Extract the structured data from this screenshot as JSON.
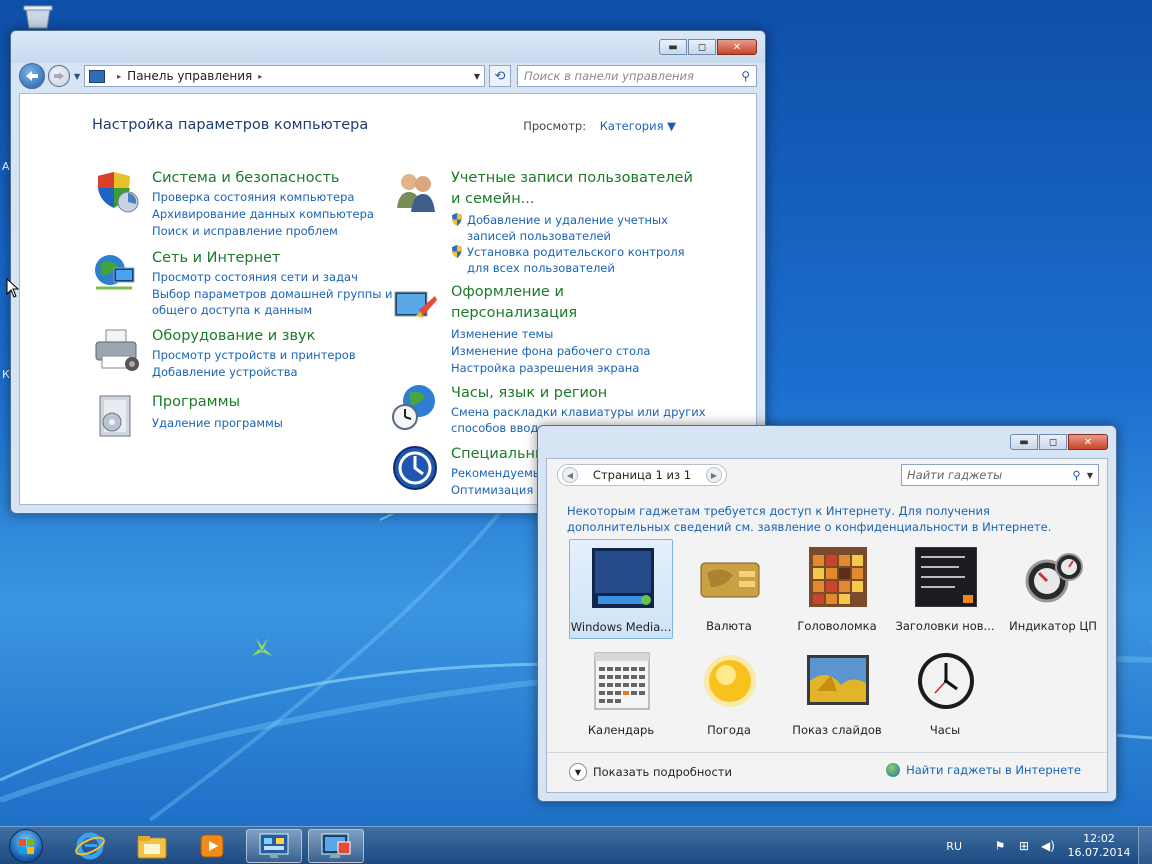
{
  "control_panel": {
    "window_buttons": {
      "minimize": "▬",
      "maximize": "◻",
      "close": "✕"
    },
    "address": {
      "segment": "Панель управления",
      "separator": "▸"
    },
    "search_placeholder": "Поиск в панели управления",
    "heading": "Настройка параметров компьютера",
    "view_by_label": "Просмотр:",
    "view_by_value": "Категория ▼",
    "categories": [
      {
        "title": "Система и безопасность",
        "icon": "shield-icon",
        "links": [
          "Проверка состояния компьютера",
          "Архивирование данных компьютера",
          "Поиск и исправление проблем"
        ]
      },
      {
        "title": "Сеть и Интернет",
        "icon": "network-icon",
        "links": [
          "Просмотр состояния сети и задач",
          "Выбор параметров домашней группы и",
          "общего доступа к данным"
        ]
      },
      {
        "title": "Оборудование и звук",
        "icon": "printer-icon",
        "links": [
          "Просмотр устройств и принтеров",
          "Добавление устройства"
        ]
      },
      {
        "title": "Программы",
        "icon": "programs-icon",
        "links": [
          "Удаление программы"
        ]
      },
      {
        "title_line1": "Учетные записи пользователей",
        "title_line2": "и семейн...",
        "icon": "users-icon",
        "links": [
          "Добавление и удаление учетных",
          "записей пользователей",
          "Установка родительского контроля",
          "для всех пользователей"
        ]
      },
      {
        "title_line1": "Оформление и",
        "title_line2": "персонализация",
        "icon": "appearance-icon",
        "links": [
          "Изменение темы",
          "Изменение фона рабочего стола",
          "Настройка разрешения экрана"
        ]
      },
      {
        "title": "Часы, язык и регион",
        "icon": "clock-globe-icon",
        "links": [
          "Смена раскладки клавиатуры или других",
          "способов ввода"
        ]
      },
      {
        "title": "Специальные возможности",
        "icon": "accessibility-icon",
        "links": [
          "Рекомендуемые параметры",
          "Оптимизация изображения"
        ]
      }
    ]
  },
  "gadgets": {
    "pager": "Страница 1 из 1",
    "search_placeholder": "Найти гаджеты",
    "notice": "Некоторым гаджетам требуется доступ к Интернету. Для получения дополнительных сведений см. заявление о конфиденциальности в Интернете.",
    "items": [
      {
        "label": "Windows Media...",
        "icon": "media-center-icon",
        "selected": true
      },
      {
        "label": "Валюта",
        "icon": "currency-icon"
      },
      {
        "label": "Головоломка",
        "icon": "puzzle-icon"
      },
      {
        "label": "Заголовки нов...",
        "icon": "feed-headlines-icon"
      },
      {
        "label": "Индикатор ЦП",
        "icon": "cpu-meter-icon"
      },
      {
        "label": "Календарь",
        "icon": "calendar-icon"
      },
      {
        "label": "Погода",
        "icon": "weather-icon"
      },
      {
        "label": "Показ слайдов",
        "icon": "slideshow-icon"
      },
      {
        "label": "Часы",
        "icon": "clock-icon"
      }
    ],
    "show_details": "Показать подробности",
    "find_online": "Найти гаджеты в Интернете"
  },
  "taskbar": {
    "language": "RU",
    "time": "12:02",
    "date": "16.07.2014",
    "pinned": [
      "internet-explorer-icon",
      "explorer-icon",
      "media-player-icon",
      "control-panel-icon",
      "gadgets-icon"
    ]
  },
  "colors": {
    "link": "#1a62b5",
    "category_title": "#1c7a2a",
    "desktop": "#1c6fcf"
  }
}
